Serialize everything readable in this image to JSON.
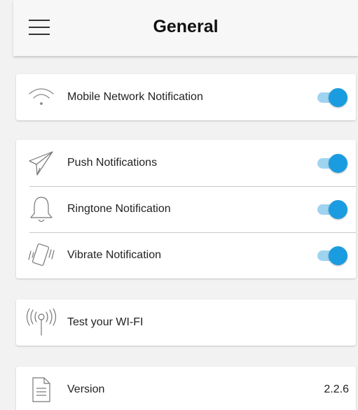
{
  "header": {
    "title": "General",
    "menu_icon": "hamburger-menu-icon"
  },
  "sections": {
    "network": {
      "mobile_network": {
        "label": "Mobile Network Notification",
        "icon": "wifi-icon",
        "enabled": true
      }
    },
    "notifications": {
      "push": {
        "label": "Push Notifications",
        "icon": "paper-plane-icon",
        "enabled": true
      },
      "ringtone": {
        "label": "Ringtone Notification",
        "icon": "bell-icon",
        "enabled": true
      },
      "vibrate": {
        "label": "Vibrate Notification",
        "icon": "vibrate-phone-icon",
        "enabled": true
      }
    },
    "wifi_test": {
      "label": "Test your WI-FI",
      "icon": "antenna-signal-icon"
    },
    "version": {
      "label": "Version",
      "value": "2.2.6",
      "icon": "document-icon"
    }
  },
  "colors": {
    "toggle_knob": "#1b9ce0",
    "toggle_track": "#9fd4f1",
    "background": "#f2f2f2"
  }
}
